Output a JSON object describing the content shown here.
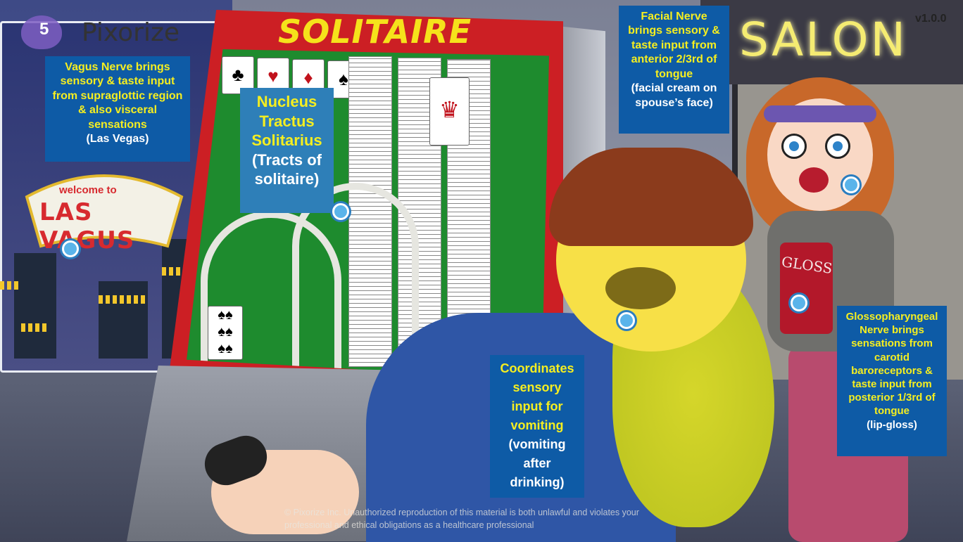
{
  "app": {
    "logo_text": "Pixorize",
    "logo_badge": "5",
    "version": "v1.0.0"
  },
  "scene": {
    "cabinet_title": "SOLITAIRE",
    "sign_welcome": "welcome to",
    "sign_city": "LAS VAGUS",
    "salon_sign": "SALON",
    "gloss_label": "GLOSS"
  },
  "labels": {
    "vagus": {
      "main": "Vagus Nerve brings sensory & taste input from supraglottic region & also visceral sensations",
      "sub": "(Las Vegas)"
    },
    "nts": {
      "main": "Nucleus Tractus Solitarius",
      "sub": "(Tracts of solitaire)"
    },
    "facial": {
      "main": "Facial Nerve brings sensory & taste input from anterior 2/3rd of tongue",
      "sub": "(facial cream on spouse’s face)"
    },
    "coordinates": {
      "main": "Coordinates sensory input for vomiting",
      "sub": "(vomiting after drinking)"
    },
    "glossopharyngeal": {
      "main": "Glossopharyngeal Nerve brings sensations from carotid baroreceptors & taste input from posterior 1/3rd of tongue",
      "sub": "(lip-gloss)"
    }
  },
  "copyright": "© Pixorize Inc. Unauthorized reproduction of this material is both unlawful and violates your professional and ethical obligations as a healthcare professional",
  "colors": {
    "label_bg": "#0e5ba6",
    "label_text": "#f5ee20",
    "hotspot": "#5ab4ea"
  }
}
